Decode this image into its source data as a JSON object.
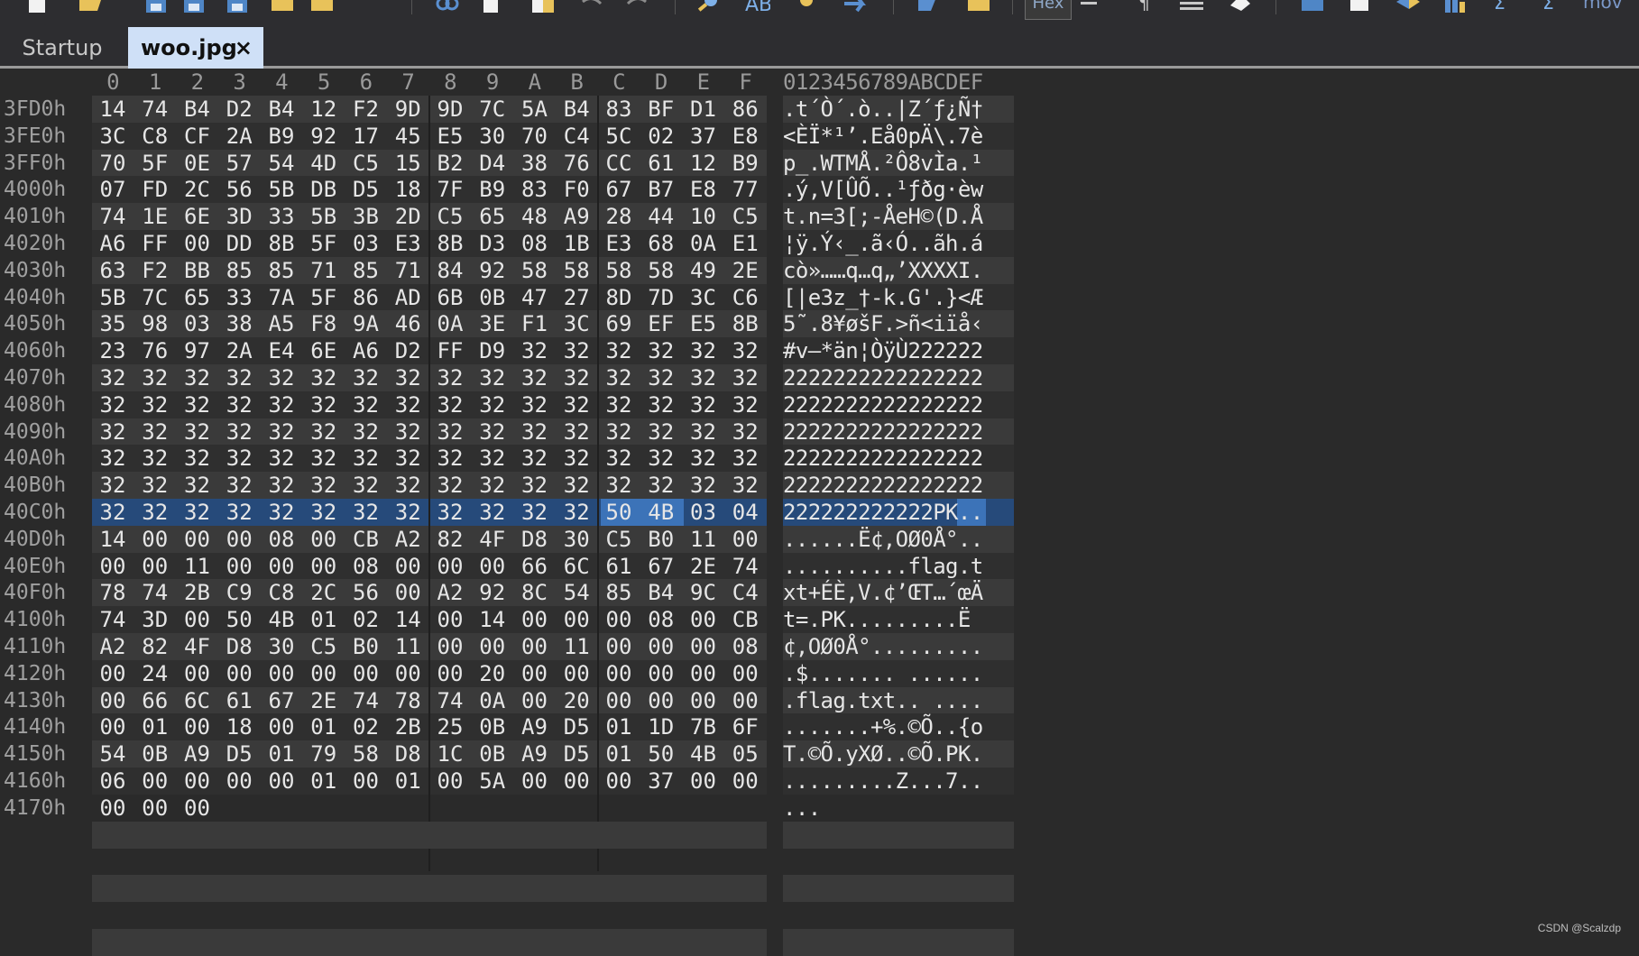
{
  "toolbar": {
    "hex_button_label": "Hex",
    "mov_label": "mov",
    "icons": [
      "new-file-icon",
      "open-folder-icon",
      "save-icon",
      "save-as-icon",
      "save-all-icon",
      "folder-icon",
      "folder-open-icon",
      "link-icon",
      "copy-icon",
      "paste-icon",
      "undo-icon",
      "redo-icon",
      "find-icon",
      "replace-icon",
      "find-next-icon",
      "goto-icon",
      "bookmark-icon",
      "bookmark-list-icon",
      "hex-toggle-icon",
      "wrap-icon",
      "pilcrow-icon",
      "list-icon",
      "erase-icon",
      "calculator-icon",
      "edit-icon",
      "swap-icon",
      "chart-icon",
      "checksum-icon",
      "compare-icon"
    ]
  },
  "tabs": [
    {
      "label": "Startup"
    },
    {
      "label": "woo.jpg",
      "close": "×"
    }
  ],
  "hex": {
    "column_headers": [
      "0",
      "1",
      "2",
      "3",
      "4",
      "5",
      "6",
      "7",
      "8",
      "9",
      "A",
      "B",
      "C",
      "D",
      "E",
      "F"
    ],
    "ascii_header": "0123456789ABCDEF",
    "rows": [
      {
        "addr": "3FD0h",
        "bytes": [
          "14",
          "74",
          "B4",
          "D2",
          "B4",
          "12",
          "F2",
          "9D",
          "9D",
          "7C",
          "5A",
          "B4",
          "83",
          "BF",
          "D1",
          "86"
        ],
        "ascii": ".t´Ò´.ò..|Z´ƒ¿Ñ†"
      },
      {
        "addr": "3FE0h",
        "bytes": [
          "3C",
          "C8",
          "CF",
          "2A",
          "B9",
          "92",
          "17",
          "45",
          "E5",
          "30",
          "70",
          "C4",
          "5C",
          "02",
          "37",
          "E8"
        ],
        "ascii": "<ÈÏ*¹’.Eå0pÄ\\.7è"
      },
      {
        "addr": "3FF0h",
        "bytes": [
          "70",
          "5F",
          "0E",
          "57",
          "54",
          "4D",
          "C5",
          "15",
          "B2",
          "D4",
          "38",
          "76",
          "CC",
          "61",
          "12",
          "B9"
        ],
        "ascii": "p_.WTMÅ.²Ô8vÌa.¹"
      },
      {
        "addr": "4000h",
        "bytes": [
          "07",
          "FD",
          "2C",
          "56",
          "5B",
          "DB",
          "D5",
          "18",
          "7F",
          "B9",
          "83",
          "F0",
          "67",
          "B7",
          "E8",
          "77"
        ],
        "ascii": ".ý,V[ÛÕ..¹ƒðg·èw"
      },
      {
        "addr": "4010h",
        "bytes": [
          "74",
          "1E",
          "6E",
          "3D",
          "33",
          "5B",
          "3B",
          "2D",
          "C5",
          "65",
          "48",
          "A9",
          "28",
          "44",
          "10",
          "C5"
        ],
        "ascii": "t.n=3[;-ÅeH©(D.Å"
      },
      {
        "addr": "4020h",
        "bytes": [
          "A6",
          "FF",
          "00",
          "DD",
          "8B",
          "5F",
          "03",
          "E3",
          "8B",
          "D3",
          "08",
          "1B",
          "E3",
          "68",
          "0A",
          "E1"
        ],
        "ascii": "¦ÿ.Ý‹_.ã‹Ó..ãh.á"
      },
      {
        "addr": "4030h",
        "bytes": [
          "63",
          "F2",
          "BB",
          "85",
          "85",
          "71",
          "85",
          "71",
          "84",
          "92",
          "58",
          "58",
          "58",
          "58",
          "49",
          "2E"
        ],
        "ascii": "cò»……q…q„’XXXXI."
      },
      {
        "addr": "4040h",
        "bytes": [
          "5B",
          "7C",
          "65",
          "33",
          "7A",
          "5F",
          "86",
          "AD",
          "6B",
          "0B",
          "47",
          "27",
          "8D",
          "7D",
          "3C",
          "C6"
        ],
        "ascii": "[|e3z_†-k.G'.}<Æ"
      },
      {
        "addr": "4050h",
        "bytes": [
          "35",
          "98",
          "03",
          "38",
          "A5",
          "F8",
          "9A",
          "46",
          "0A",
          "3E",
          "F1",
          "3C",
          "69",
          "EF",
          "E5",
          "8B"
        ],
        "ascii": "5˜.8¥øšF.>ñ<iïå‹"
      },
      {
        "addr": "4060h",
        "bytes": [
          "23",
          "76",
          "97",
          "2A",
          "E4",
          "6E",
          "A6",
          "D2",
          "FF",
          "D9",
          "32",
          "32",
          "32",
          "32",
          "32",
          "32"
        ],
        "ascii": "#v—*än¦ÒÿÙ222222"
      },
      {
        "addr": "4070h",
        "bytes": [
          "32",
          "32",
          "32",
          "32",
          "32",
          "32",
          "32",
          "32",
          "32",
          "32",
          "32",
          "32",
          "32",
          "32",
          "32",
          "32"
        ],
        "ascii": "2222222222222222"
      },
      {
        "addr": "4080h",
        "bytes": [
          "32",
          "32",
          "32",
          "32",
          "32",
          "32",
          "32",
          "32",
          "32",
          "32",
          "32",
          "32",
          "32",
          "32",
          "32",
          "32"
        ],
        "ascii": "2222222222222222"
      },
      {
        "addr": "4090h",
        "bytes": [
          "32",
          "32",
          "32",
          "32",
          "32",
          "32",
          "32",
          "32",
          "32",
          "32",
          "32",
          "32",
          "32",
          "32",
          "32",
          "32"
        ],
        "ascii": "2222222222222222"
      },
      {
        "addr": "40A0h",
        "bytes": [
          "32",
          "32",
          "32",
          "32",
          "32",
          "32",
          "32",
          "32",
          "32",
          "32",
          "32",
          "32",
          "32",
          "32",
          "32",
          "32"
        ],
        "ascii": "2222222222222222"
      },
      {
        "addr": "40B0h",
        "bytes": [
          "32",
          "32",
          "32",
          "32",
          "32",
          "32",
          "32",
          "32",
          "32",
          "32",
          "32",
          "32",
          "32",
          "32",
          "32",
          "32"
        ],
        "ascii": "2222222222222222"
      },
      {
        "addr": "40C0h",
        "bytes": [
          "32",
          "32",
          "32",
          "32",
          "32",
          "32",
          "32",
          "32",
          "32",
          "32",
          "32",
          "32",
          "50",
          "4B",
          "03",
          "04"
        ],
        "ascii": "222222222222PK.."
      },
      {
        "addr": "40D0h",
        "bytes": [
          "14",
          "00",
          "00",
          "00",
          "08",
          "00",
          "CB",
          "A2",
          "82",
          "4F",
          "D8",
          "30",
          "C5",
          "B0",
          "11",
          "00"
        ],
        "ascii": "......Ë¢‚OØ0Å°.."
      },
      {
        "addr": "40E0h",
        "bytes": [
          "00",
          "00",
          "11",
          "00",
          "00",
          "00",
          "08",
          "00",
          "00",
          "00",
          "66",
          "6C",
          "61",
          "67",
          "2E",
          "74"
        ],
        "ascii": "..........flag.t"
      },
      {
        "addr": "40F0h",
        "bytes": [
          "78",
          "74",
          "2B",
          "C9",
          "C8",
          "2C",
          "56",
          "00",
          "A2",
          "92",
          "8C",
          "54",
          "85",
          "B4",
          "9C",
          "C4"
        ],
        "ascii": "xt+ÉÈ,V.¢’ŒT…´œÄ"
      },
      {
        "addr": "4100h",
        "bytes": [
          "74",
          "3D",
          "00",
          "50",
          "4B",
          "01",
          "02",
          "14",
          "00",
          "14",
          "00",
          "00",
          "00",
          "08",
          "00",
          "CB"
        ],
        "ascii": "t=.PK.........Ë"
      },
      {
        "addr": "4110h",
        "bytes": [
          "A2",
          "82",
          "4F",
          "D8",
          "30",
          "C5",
          "B0",
          "11",
          "00",
          "00",
          "00",
          "11",
          "00",
          "00",
          "00",
          "08"
        ],
        "ascii": "¢‚OØ0Å°........."
      },
      {
        "addr": "4120h",
        "bytes": [
          "00",
          "24",
          "00",
          "00",
          "00",
          "00",
          "00",
          "00",
          "00",
          "20",
          "00",
          "00",
          "00",
          "00",
          "00",
          "00"
        ],
        "ascii": ".$....... ......"
      },
      {
        "addr": "4130h",
        "bytes": [
          "00",
          "66",
          "6C",
          "61",
          "67",
          "2E",
          "74",
          "78",
          "74",
          "0A",
          "00",
          "20",
          "00",
          "00",
          "00",
          "00"
        ],
        "ascii": ".flag.txt.. ...."
      },
      {
        "addr": "4140h",
        "bytes": [
          "00",
          "01",
          "00",
          "18",
          "00",
          "01",
          "02",
          "2B",
          "25",
          "0B",
          "A9",
          "D5",
          "01",
          "1D",
          "7B",
          "6F"
        ],
        "ascii": ".......+%.©Õ..{o"
      },
      {
        "addr": "4150h",
        "bytes": [
          "54",
          "0B",
          "A9",
          "D5",
          "01",
          "79",
          "58",
          "D8",
          "1C",
          "0B",
          "A9",
          "D5",
          "01",
          "50",
          "4B",
          "05"
        ],
        "ascii": "T.©Õ.yXØ..©Õ.PK."
      },
      {
        "addr": "4160h",
        "bytes": [
          "06",
          "00",
          "00",
          "00",
          "00",
          "01",
          "00",
          "01",
          "00",
          "5A",
          "00",
          "00",
          "00",
          "37",
          "00",
          "00"
        ],
        "ascii": ".........Z...7.."
      },
      {
        "addr": "4170h",
        "bytes": [
          "00",
          "00",
          "00"
        ],
        "ascii": "..."
      }
    ]
  },
  "watermark": "CSDN @Scalzdp"
}
